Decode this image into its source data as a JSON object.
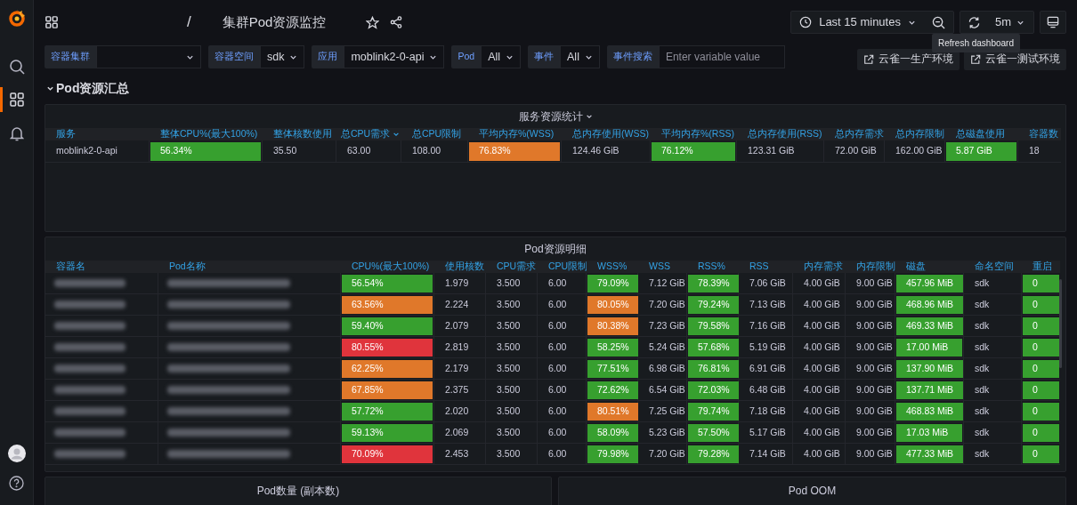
{
  "breadcrumb": {
    "separator": "/",
    "title": "集群Pod资源监控"
  },
  "toolbar": {
    "time_range": "Last 15 minutes",
    "refresh_interval": "5m",
    "tooltip": "Refresh dashboard"
  },
  "variables": [
    {
      "label": "容器集群",
      "kind": "select"
    },
    {
      "label": "容器空间",
      "kind": "select",
      "value": "sdk"
    },
    {
      "label": "应用",
      "kind": "select",
      "value": "moblink2-0-api"
    },
    {
      "label": "Pod",
      "kind": "select",
      "value": "All"
    },
    {
      "label": "事件",
      "kind": "select",
      "value": "All"
    },
    {
      "label": "事件搜索",
      "kind": "text",
      "placeholder": "Enter variable value"
    }
  ],
  "links": [
    "云雀一生产环境",
    "云雀一测试环境"
  ],
  "row_title": "Pod资源汇总",
  "summary_panel": {
    "title": "服务资源统计",
    "columns": [
      {
        "label": "服务"
      },
      {
        "label": "整体CPU%(最大100%)"
      },
      {
        "label": "整体核数使用"
      },
      {
        "label": "总CPU需求",
        "sorted": true
      },
      {
        "label": "总CPU限制"
      },
      {
        "label": "平均内存%(WSS)"
      },
      {
        "label": "总内存使用(WSS)"
      },
      {
        "label": "平均内存%(RSS)"
      },
      {
        "label": "总内存使用(RSS)"
      },
      {
        "label": "总内存需求"
      },
      {
        "label": "总内存限制"
      },
      {
        "label": "总磁盘使用"
      },
      {
        "label": "容器数"
      }
    ],
    "rows": [
      [
        {
          "text": "moblink2-0-api"
        },
        {
          "text": "56.34%",
          "color": "#37a02f"
        },
        {
          "text": "35.50"
        },
        {
          "text": "63.00"
        },
        {
          "text": "108.00"
        },
        {
          "text": "76.83%",
          "color": "#e0782a"
        },
        {
          "text": "124.46 GiB"
        },
        {
          "text": "76.12%",
          "color": "#37a02f"
        },
        {
          "text": "123.31 GiB"
        },
        {
          "text": "72.00 GiB"
        },
        {
          "text": "162.00 GiB"
        },
        {
          "text": "5.87 GiB",
          "color": "#37a02f"
        },
        {
          "text": "18"
        }
      ]
    ]
  },
  "detail_panel": {
    "title": "Pod资源明细",
    "columns": [
      "容器名",
      "Pod名称",
      "CPU%(最大100%)",
      "使用核数",
      "CPU需求",
      "CPU限制",
      "WSS%",
      "WSS",
      "RSS%",
      "RSS",
      "内存需求",
      "内存限制",
      "磁盘",
      "命名空间",
      "重启"
    ],
    "rows": [
      [
        {
          "kind": "blurred"
        },
        {
          "kind": "blurred"
        },
        {
          "text": "56.54%",
          "color": "#37a02f"
        },
        {
          "text": "1.979"
        },
        {
          "text": "3.500"
        },
        {
          "text": "6.00"
        },
        {
          "text": "79.09%",
          "color": "#37a02f"
        },
        {
          "text": "7.12 GiB"
        },
        {
          "text": "78.39%",
          "color": "#37a02f"
        },
        {
          "text": "7.06 GiB"
        },
        {
          "text": "4.00 GiB"
        },
        {
          "text": "9.00 GiB"
        },
        {
          "text": "457.96 MiB",
          "color": "#37a02f"
        },
        {
          "text": "sdk"
        },
        {
          "text": "0",
          "color": "#37a02f"
        }
      ],
      [
        {
          "kind": "blurred"
        },
        {
          "kind": "blurred"
        },
        {
          "text": "63.56%",
          "color": "#e0782a"
        },
        {
          "text": "2.224"
        },
        {
          "text": "3.500"
        },
        {
          "text": "6.00"
        },
        {
          "text": "80.05%",
          "color": "#e0782a"
        },
        {
          "text": "7.20 GiB"
        },
        {
          "text": "79.24%",
          "color": "#37a02f"
        },
        {
          "text": "7.13 GiB"
        },
        {
          "text": "4.00 GiB"
        },
        {
          "text": "9.00 GiB"
        },
        {
          "text": "468.96 MiB",
          "color": "#37a02f"
        },
        {
          "text": "sdk"
        },
        {
          "text": "0",
          "color": "#37a02f"
        }
      ],
      [
        {
          "kind": "blurred"
        },
        {
          "kind": "blurred"
        },
        {
          "text": "59.40%",
          "color": "#37a02f"
        },
        {
          "text": "2.079"
        },
        {
          "text": "3.500"
        },
        {
          "text": "6.00"
        },
        {
          "text": "80.38%",
          "color": "#e0782a"
        },
        {
          "text": "7.23 GiB"
        },
        {
          "text": "79.58%",
          "color": "#37a02f"
        },
        {
          "text": "7.16 GiB"
        },
        {
          "text": "4.00 GiB"
        },
        {
          "text": "9.00 GiB"
        },
        {
          "text": "469.33 MiB",
          "color": "#37a02f"
        },
        {
          "text": "sdk"
        },
        {
          "text": "0",
          "color": "#37a02f"
        }
      ],
      [
        {
          "kind": "blurred"
        },
        {
          "kind": "blurred"
        },
        {
          "text": "80.55%",
          "color": "#e0343c"
        },
        {
          "text": "2.819"
        },
        {
          "text": "3.500"
        },
        {
          "text": "6.00"
        },
        {
          "text": "58.25%",
          "color": "#37a02f"
        },
        {
          "text": "5.24 GiB"
        },
        {
          "text": "57.68%",
          "color": "#37a02f"
        },
        {
          "text": "5.19 GiB"
        },
        {
          "text": "4.00 GiB"
        },
        {
          "text": "9.00 GiB"
        },
        {
          "text": "17.00 MiB",
          "color": "#37a02f"
        },
        {
          "text": "sdk"
        },
        {
          "text": "0",
          "color": "#37a02f"
        }
      ],
      [
        {
          "kind": "blurred"
        },
        {
          "kind": "blurred"
        },
        {
          "text": "62.25%",
          "color": "#e0782a"
        },
        {
          "text": "2.179"
        },
        {
          "text": "3.500"
        },
        {
          "text": "6.00"
        },
        {
          "text": "77.51%",
          "color": "#37a02f"
        },
        {
          "text": "6.98 GiB"
        },
        {
          "text": "76.81%",
          "color": "#37a02f"
        },
        {
          "text": "6.91 GiB"
        },
        {
          "text": "4.00 GiB"
        },
        {
          "text": "9.00 GiB"
        },
        {
          "text": "137.90 MiB",
          "color": "#37a02f"
        },
        {
          "text": "sdk"
        },
        {
          "text": "0",
          "color": "#37a02f"
        }
      ],
      [
        {
          "kind": "blurred"
        },
        {
          "kind": "blurred"
        },
        {
          "text": "67.85%",
          "color": "#e0782a"
        },
        {
          "text": "2.375"
        },
        {
          "text": "3.500"
        },
        {
          "text": "6.00"
        },
        {
          "text": "72.62%",
          "color": "#37a02f"
        },
        {
          "text": "6.54 GiB"
        },
        {
          "text": "72.03%",
          "color": "#37a02f"
        },
        {
          "text": "6.48 GiB"
        },
        {
          "text": "4.00 GiB"
        },
        {
          "text": "9.00 GiB"
        },
        {
          "text": "137.71 MiB",
          "color": "#37a02f"
        },
        {
          "text": "sdk"
        },
        {
          "text": "0",
          "color": "#37a02f"
        }
      ],
      [
        {
          "kind": "blurred"
        },
        {
          "kind": "blurred"
        },
        {
          "text": "57.72%",
          "color": "#37a02f"
        },
        {
          "text": "2.020"
        },
        {
          "text": "3.500"
        },
        {
          "text": "6.00"
        },
        {
          "text": "80.51%",
          "color": "#e0782a"
        },
        {
          "text": "7.25 GiB"
        },
        {
          "text": "79.74%",
          "color": "#37a02f"
        },
        {
          "text": "7.18 GiB"
        },
        {
          "text": "4.00 GiB"
        },
        {
          "text": "9.00 GiB"
        },
        {
          "text": "468.83 MiB",
          "color": "#37a02f"
        },
        {
          "text": "sdk"
        },
        {
          "text": "0",
          "color": "#37a02f"
        }
      ],
      [
        {
          "kind": "blurred"
        },
        {
          "kind": "blurred"
        },
        {
          "text": "59.13%",
          "color": "#37a02f"
        },
        {
          "text": "2.069"
        },
        {
          "text": "3.500"
        },
        {
          "text": "6.00"
        },
        {
          "text": "58.09%",
          "color": "#37a02f"
        },
        {
          "text": "5.23 GiB"
        },
        {
          "text": "57.50%",
          "color": "#37a02f"
        },
        {
          "text": "5.17 GiB"
        },
        {
          "text": "4.00 GiB"
        },
        {
          "text": "9.00 GiB"
        },
        {
          "text": "17.03 MiB",
          "color": "#37a02f"
        },
        {
          "text": "sdk"
        },
        {
          "text": "0",
          "color": "#37a02f"
        }
      ],
      [
        {
          "kind": "blurred"
        },
        {
          "kind": "blurred"
        },
        {
          "text": "70.09%",
          "color": "#e0343c"
        },
        {
          "text": "2.453"
        },
        {
          "text": "3.500"
        },
        {
          "text": "6.00"
        },
        {
          "text": "79.98%",
          "color": "#37a02f"
        },
        {
          "text": "7.20 GiB"
        },
        {
          "text": "79.28%",
          "color": "#37a02f"
        },
        {
          "text": "7.14 GiB"
        },
        {
          "text": "4.00 GiB"
        },
        {
          "text": "9.00 GiB"
        },
        {
          "text": "477.33 MiB",
          "color": "#37a02f"
        },
        {
          "text": "sdk"
        },
        {
          "text": "0",
          "color": "#37a02f"
        }
      ]
    ]
  },
  "bottom_panels": [
    {
      "title": "Pod数量 (副本数)"
    },
    {
      "title": "Pod OOM"
    }
  ]
}
